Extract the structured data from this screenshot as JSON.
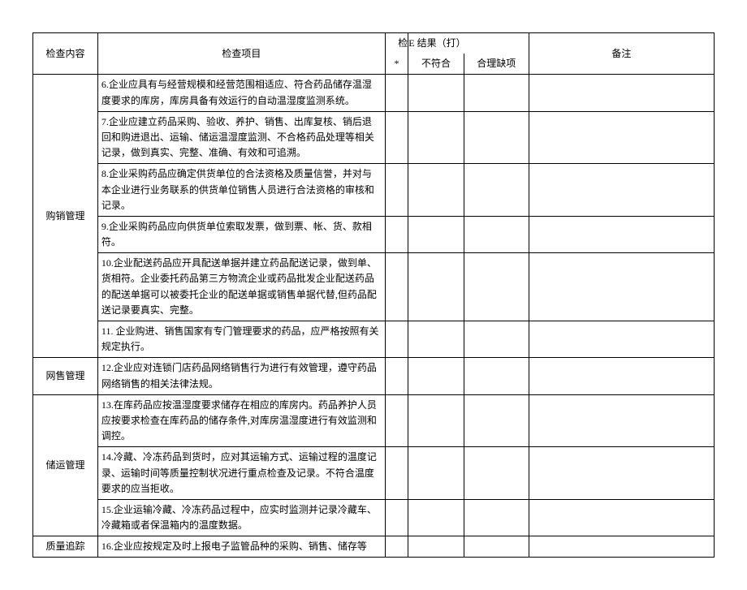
{
  "header": {
    "col_category": "检查内容",
    "col_item": "检查项目",
    "col_result_pre": "检",
    "col_result_main": "E 结果（打）",
    "col_remark": "备注",
    "sub_star": "*",
    "sub_fail": "不符合",
    "sub_defect": "合理缺项"
  },
  "rows": [
    {
      "cat": "",
      "item": "6.企业应具有与经营规模和经营范围相适应、符合药品储存温湿度要求的库房，库房具备有效运行的自动温湿度监测系统。"
    },
    {
      "cat": "",
      "item": "7.企业应建立药品采购、验收、养护、销售、出库复核、销后退回和购进退出、运输、储运温湿度监测、不合格药品处理等相关记录，做到真实、完整、准确、有效和可追溯。"
    },
    {
      "cat": "",
      "item": "8.企业采购药品应确定供货单位的合法资格及质量信誉，并对与本企业进行业务联系的供货单位销售人员进行合法资格的审核和记录。"
    },
    {
      "cat": "",
      "item": "9.企业采购药品应向供货单位索取发票，做到票、帐、货、款相符。"
    },
    {
      "cat": "购销管理",
      "item": "10.企业配送药品应开具配送单据并建立药品配送记录，做到单、货相符。企业委托药品第三方物流企业或药品批发企业配送药品的配送单据可以被委托企业的配送单据或销售单据代替,但药品配送记录要真实、完整。"
    },
    {
      "cat": "",
      "item": "11. 企业购进、销售国家有专门管理要求的药品，应严格按照有关规定执行。"
    },
    {
      "cat": "网售管理",
      "item": "12.企业应对连锁门店药品网络销售行为进行有效管理，遵守药品网络销售的相关法律法规。"
    },
    {
      "cat": "",
      "item": "13.在库药品应按温湿度要求储存在相应的库房内。药品养护人员应按要求检查在库药品的储存条件,对库房温湿度进行有效监测和调控。"
    },
    {
      "cat": "储运管理",
      "item": "14.冷藏、冷冻药品到货时，应对其运输方式、运输过程的温度记录、运输时间等质量控制状况进行重点检查及记录。不符合温度要求的应当拒收。"
    },
    {
      "cat": "",
      "item": "15.企业运输冷藏、冷冻药品过程中，应实时监测并记录冷藏车、冷藏箱或者保温箱内的温度数据。"
    },
    {
      "cat": "质量追踪",
      "item": "16.企业应按规定及时上报电子监管品种的采购、销售、储存等"
    }
  ]
}
